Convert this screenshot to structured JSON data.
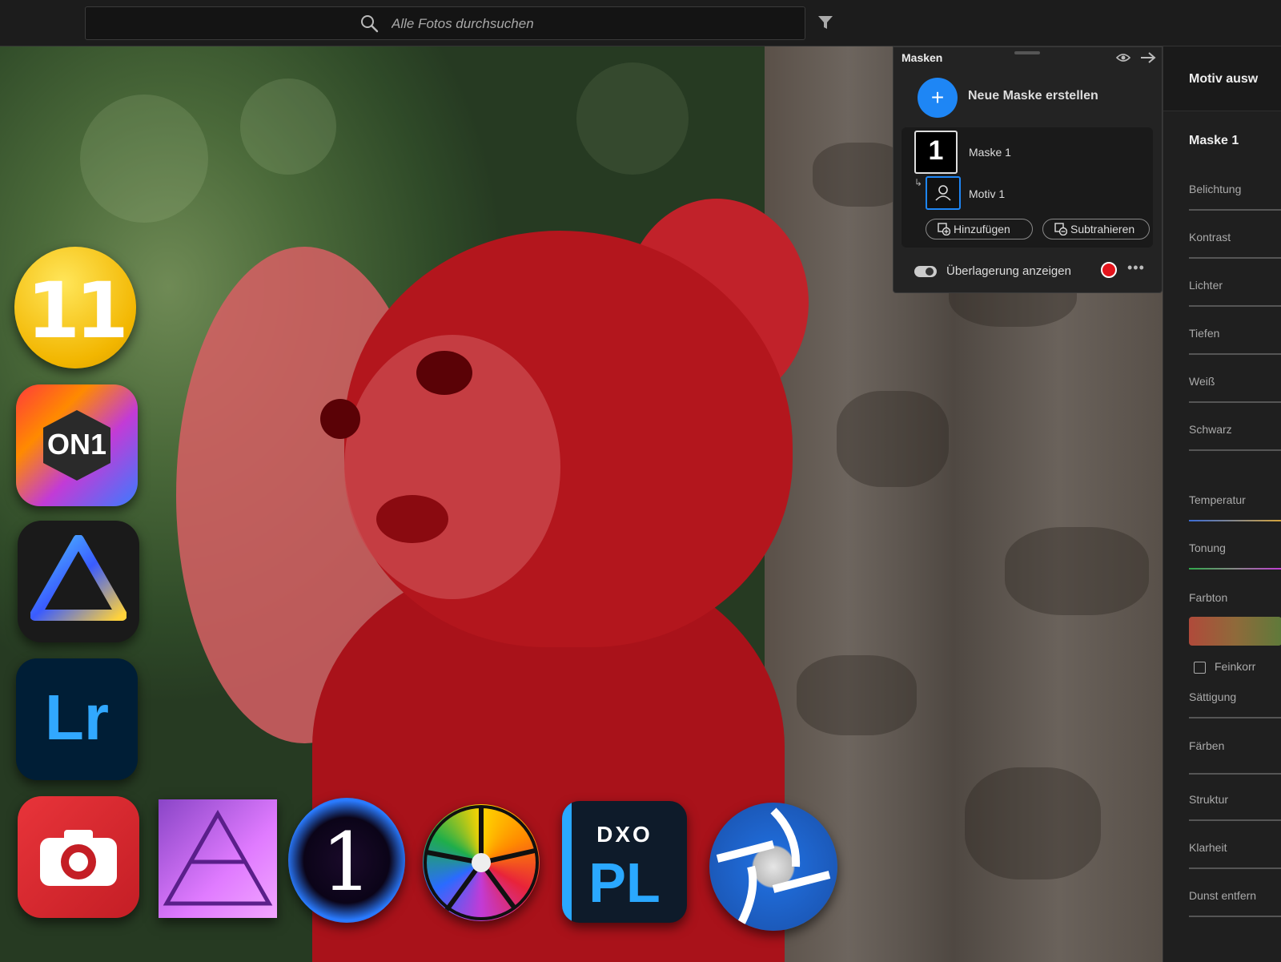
{
  "search": {
    "placeholder": "Alle Fotos durchsuchen"
  },
  "masks_panel": {
    "title": "Masken",
    "new_mask_label": "Neue Maske erstellen",
    "mask_name": "Maske 1",
    "mask_thumb_glyph": "1",
    "component_name": "Motiv 1",
    "add_label": "Hinzufügen",
    "subtract_label": "Subtrahieren",
    "overlay_label": "Überlagerung anzeigen",
    "overlay_color": "#e3141c",
    "accent_color": "#1e86f5"
  },
  "right_panel": {
    "title": "Motiv ausw",
    "mask_name": "Maske 1",
    "sliders": [
      "Belichtung",
      "Kontrast",
      "Lichter",
      "Tiefen",
      "Weiß",
      "Schwarz",
      "Temperatur",
      "Tonung",
      "Farbton"
    ],
    "checkbox_label": "Feinkorr",
    "sliders_2": [
      "Sättigung",
      "Färben",
      "Struktur",
      "Klarheit",
      "Dunst entfern"
    ]
  },
  "app_icons": {
    "icon_11_label": "11",
    "on1_label": "ON1",
    "lr_label": "Lr",
    "capture_one_label": "1",
    "dxo_top": "DXO",
    "dxo_bottom": "PL"
  }
}
